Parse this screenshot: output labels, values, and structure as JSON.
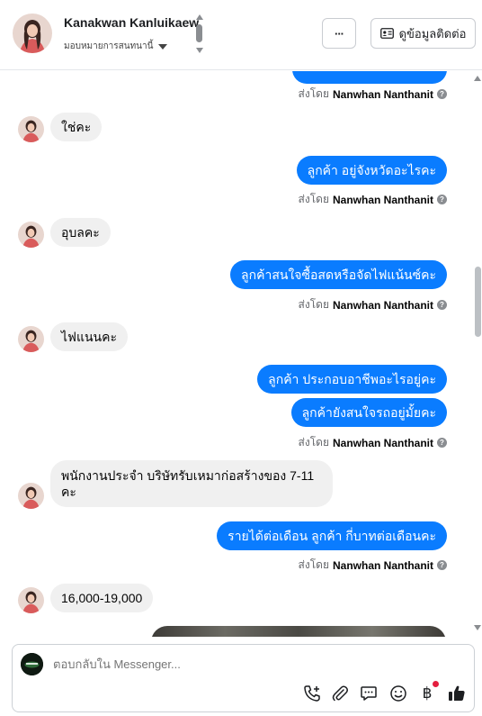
{
  "header": {
    "name": "Kanakwan Kanluikaew",
    "assign_label": "มอบหมายการสนทนานี้",
    "more_label": "···",
    "contact_button": "ดูข้อมูลติดต่อ"
  },
  "messages": {
    "sent_by_prefix": "ส่งโดย",
    "agent_name": "Nanwhan Nanthanit",
    "in1": "ใช่คะ",
    "out1": "ลูกค้า อยู่จังหวัดอะไรคะ",
    "in2": "อุบลคะ",
    "out2": "ลูกค้าสนใจซื้อสดหรือจัดไฟแน้นซ์คะ",
    "in3": "ไฟแนนคะ",
    "out3a": "ลูกค้า ประกอบอาชีพอะไรอยู่คะ",
    "out3b": "ลูกค้ายังสนใจรถอยู่มั้ยคะ",
    "in4_line1": "พนักงานประจำ บริษัทรับเหมาก่อสร้างของ 7-11",
    "in4_line2": "คะ",
    "out4": "รายได้ต่อเดือน ลูกค้า กี่บาทต่อเดือนคะ",
    "in5": "16,000-19,000"
  },
  "composer": {
    "placeholder": "ตอบกลับใน Messenger..."
  },
  "colors": {
    "outgoing": "#0a7cff",
    "incoming": "#f0f0f0",
    "like": "#1c1e21"
  }
}
